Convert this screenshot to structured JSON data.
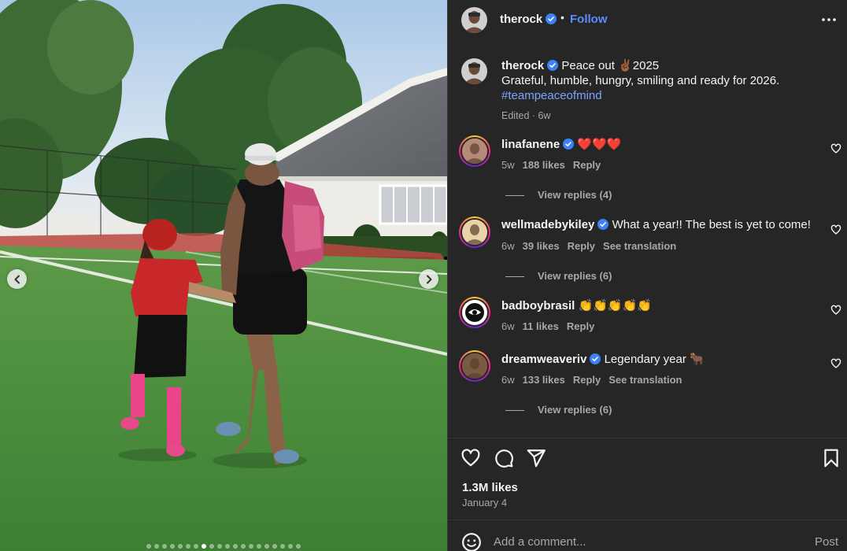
{
  "header": {
    "username": "therock",
    "separator": "•",
    "follow_label": "Follow"
  },
  "caption": {
    "username": "therock",
    "line1": "Peace out ✌🏾2025",
    "line2": "Grateful, humble, hungry, smiling and ready for 2026.",
    "hashtag": "#teampeaceofmind",
    "meta": "Edited · 6w"
  },
  "comments": [
    {
      "username": "linafanene",
      "verified": true,
      "text": "❤️❤️❤️",
      "age": "5w",
      "likes": "188 likes",
      "reply": "Reply",
      "translate": "",
      "view_replies": "View replies (4)"
    },
    {
      "username": "wellmadebykiley",
      "verified": true,
      "text": "What a year!! The best is yet to come!",
      "age": "6w",
      "likes": "39 likes",
      "reply": "Reply",
      "translate": "See translation",
      "view_replies": "View replies (6)"
    },
    {
      "username": "badboybrasil",
      "verified": false,
      "text": "👏👏👏👏👏",
      "age": "6w",
      "likes": "11 likes",
      "reply": "Reply",
      "translate": "",
      "view_replies": ""
    },
    {
      "username": "dreamweaveriv",
      "verified": true,
      "text": "Legendary year 🐂",
      "age": "6w",
      "likes": "133 likes",
      "reply": "Reply",
      "translate": "See translation",
      "view_replies": "View replies (6)"
    }
  ],
  "footer": {
    "likes": "1.3M likes",
    "date": "January 4",
    "comment_placeholder": "Add a comment...",
    "post_label": "Post"
  },
  "carousel": {
    "total_slides": 20,
    "active_index": 7
  },
  "colors": {
    "panel_bg": "#262626",
    "link": "#5b8dff",
    "hashtag": "#7aa5ff",
    "muted": "#a8a8a8",
    "verified": "#3b82f6"
  },
  "icons": [
    "chevron-left-icon",
    "chevron-right-icon",
    "more-icon",
    "verified-icon",
    "heart-icon",
    "comment-icon",
    "share-icon",
    "bookmark-icon",
    "emoji-icon"
  ]
}
